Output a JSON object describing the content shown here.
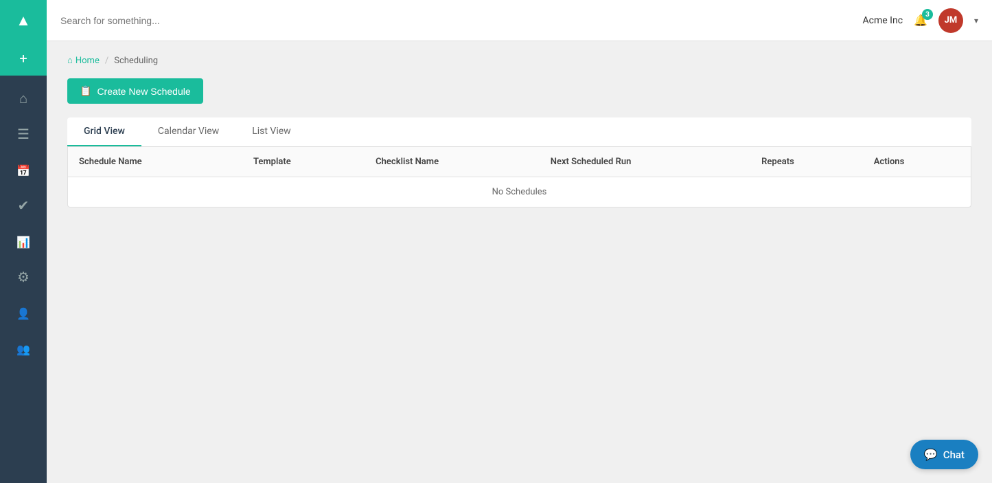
{
  "sidebar": {
    "logo_icon": "logo-icon",
    "add_icon": "plus-icon",
    "items": [
      {
        "id": "home",
        "icon": "home-icon",
        "label": "Home",
        "active": false
      },
      {
        "id": "list",
        "icon": "list-icon",
        "label": "List",
        "active": false
      },
      {
        "id": "calendar",
        "icon": "calendar-icon",
        "label": "Calendar",
        "active": true
      },
      {
        "id": "checklist",
        "icon": "checklist-icon",
        "label": "Checklist",
        "active": false
      },
      {
        "id": "chart",
        "icon": "chart-icon",
        "label": "Chart",
        "active": false
      },
      {
        "id": "gear",
        "icon": "gear-icon",
        "label": "Settings",
        "active": false
      },
      {
        "id": "user",
        "icon": "user-icon",
        "label": "User",
        "active": false
      },
      {
        "id": "group",
        "icon": "group-icon",
        "label": "Group",
        "active": false
      }
    ]
  },
  "topbar": {
    "search_placeholder": "Search for something...",
    "company": "Acme Inc",
    "notification_count": "3",
    "avatar_initials": "JM"
  },
  "breadcrumb": {
    "home_label": "Home",
    "separator": "/",
    "current": "Scheduling"
  },
  "create_button": {
    "label": "Create New Schedule"
  },
  "tabs": [
    {
      "id": "grid",
      "label": "Grid View",
      "active": true
    },
    {
      "id": "calendar",
      "label": "Calendar View",
      "active": false
    },
    {
      "id": "list",
      "label": "List View",
      "active": false
    }
  ],
  "table": {
    "columns": [
      {
        "id": "schedule_name",
        "label": "Schedule Name"
      },
      {
        "id": "template",
        "label": "Template"
      },
      {
        "id": "checklist_name",
        "label": "Checklist Name"
      },
      {
        "id": "next_scheduled_run",
        "label": "Next Scheduled Run"
      },
      {
        "id": "repeats",
        "label": "Repeats"
      },
      {
        "id": "actions",
        "label": "Actions"
      }
    ],
    "empty_message": "No Schedules"
  },
  "chat": {
    "label": "Chat"
  }
}
